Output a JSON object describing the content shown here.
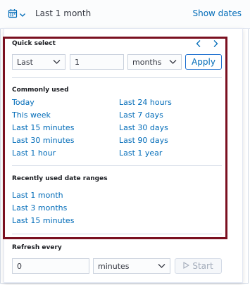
{
  "header": {
    "calendar_icon": "calendar-icon",
    "range_label": "Last 1 month",
    "show_dates_label": "Show dates"
  },
  "quick_select": {
    "title": "Quick select",
    "prev_icon": "chevron-left-icon",
    "next_icon": "chevron-right-icon",
    "direction": "Last",
    "amount": "1",
    "unit": "months",
    "apply_label": "Apply"
  },
  "commonly_used": {
    "title": "Commonly used",
    "items": [
      "Today",
      "This week",
      "Last 15 minutes",
      "Last 30 minutes",
      "Last 1 hour",
      "Last 24 hours",
      "Last 7 days",
      "Last 30 days",
      "Last 90 days",
      "Last 1 year"
    ]
  },
  "recent_ranges": {
    "title": "Recently used date ranges",
    "items": [
      "Last 1 month",
      "Last 3 months",
      "Last 15 minutes"
    ]
  },
  "refresh": {
    "title": "Refresh every",
    "interval_value": "0",
    "interval_unit": "minutes",
    "start_label": "Start"
  },
  "colors": {
    "link": "#006bb8",
    "highlight_border": "#7a1020"
  }
}
